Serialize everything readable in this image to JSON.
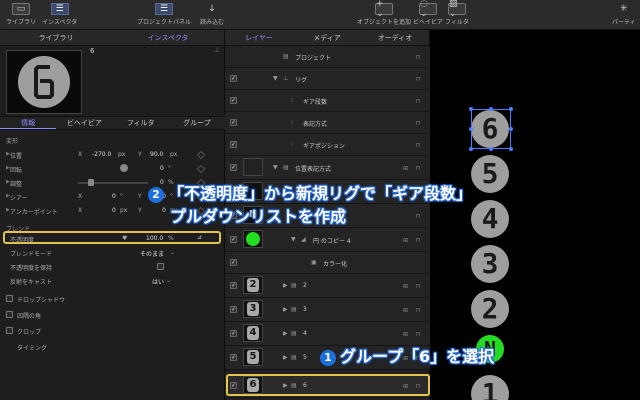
{
  "toolbar": {
    "library": "ライブラリ",
    "inspector": "インスペクタ",
    "project_panel": "プロジェクトパネル",
    "import": "読み込む",
    "add_object": "オブジェクトを追加",
    "behavior": "ビヘイビア",
    "filter": "フィルタ",
    "particles": "パーティ"
  },
  "left": {
    "tabs": [
      "ライブラリ",
      "インスペクタ"
    ],
    "preview_name": "6",
    "sub_tabs": [
      "情報",
      "ビヘイビア",
      "フィルタ",
      "グループ"
    ],
    "transform_header": "変形",
    "position": {
      "label": "位置",
      "x_label": "X",
      "x": "-270.0",
      "x_unit": "px",
      "y_label": "Y",
      "y": "90.0",
      "y_unit": "px"
    },
    "rotation": {
      "label": "回転",
      "value": "0",
      "unit": "°"
    },
    "scale": {
      "label": "調整",
      "value": "0",
      "unit": "%"
    },
    "shear": {
      "label": "シアー",
      "x_label": "X",
      "x": "0",
      "x_unit": "°",
      "y_label": "Y",
      "y": "0",
      "y_unit": "°"
    },
    "anchor": {
      "label": "アンカーポイント",
      "x_label": "X",
      "x": "0",
      "x_unit": "px",
      "y_label": "Y",
      "y": "0",
      "y_unit": "px"
    },
    "blend_header": "ブレンド",
    "opacity": {
      "label": "不透明度",
      "value": "100.0",
      "unit": "%"
    },
    "blend_mode": {
      "label": "ブレンドモード",
      "value": "そのまま"
    },
    "preserve_opacity": {
      "label": "不透明度を保持"
    },
    "shadow_cast": {
      "label": "反射をキャスト",
      "value": "はい"
    },
    "drop_shadow": "ドロップシャドウ",
    "four_corner": "四隅の角",
    "crop": "クロップ",
    "timing": "タイミング"
  },
  "layers": {
    "tabs": [
      "レイヤー",
      "メディア",
      "オーディオ"
    ],
    "rows": [
      {
        "label": "プロジェクト"
      },
      {
        "label": "リグ"
      },
      {
        "label": "ギア段数"
      },
      {
        "label": "表記方式"
      },
      {
        "label": "ギアポジション"
      },
      {
        "label": "位置表記方式"
      },
      {
        "label": "A"
      },
      {
        "label": "N"
      },
      {
        "label": "円 のコピー 4"
      },
      {
        "label": "カラー化"
      },
      {
        "label": "2"
      },
      {
        "label": "3"
      },
      {
        "label": "4"
      },
      {
        "label": "5"
      },
      {
        "label": "6"
      }
    ],
    "thumbs": [
      "N",
      "2",
      "3",
      "4",
      "5",
      "6"
    ]
  },
  "canvas": {
    "digits": [
      "6",
      "5",
      "4",
      "3",
      "2",
      "N",
      "1"
    ]
  },
  "annotations": {
    "step1_num": "1",
    "step1_text": "グループ「6」を選択",
    "step2_num": "2",
    "step2_line1": "「不透明度」から新規リグで「ギア段数」",
    "step2_line2": "プルダウンリストを作成"
  },
  "colors": {
    "accent": "#8b8fff",
    "highlight": "#e2c44b",
    "annotation": "#1d6fe0",
    "green": "#22dd22"
  }
}
